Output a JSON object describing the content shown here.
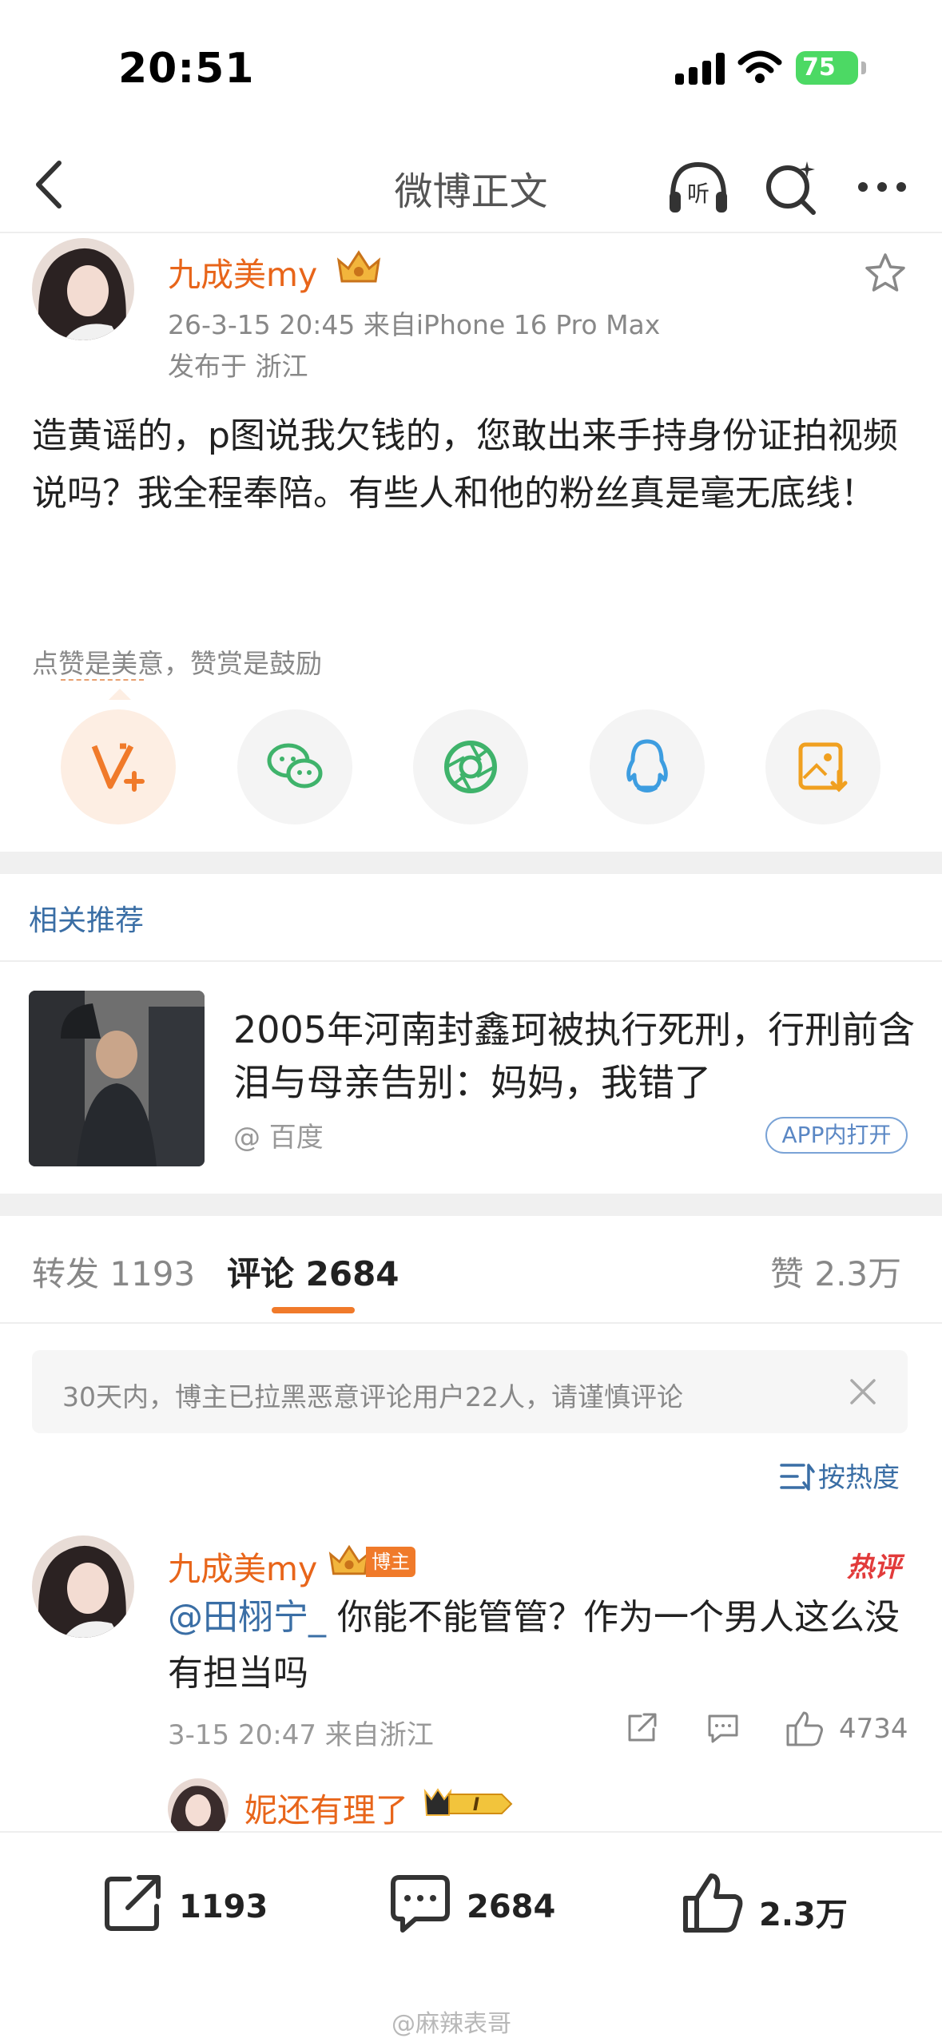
{
  "status_bar": {
    "time": "20:51",
    "battery": "75"
  },
  "nav": {
    "title": "微博正文"
  },
  "post": {
    "username": "九成美my",
    "meta": "26-3-15 20:45  来自iPhone 16 Pro Max",
    "location": "发布于 浙江",
    "body": "造黄谣的，p图说我欠钱的，您敢出来手持身份证拍视频说吗？我全程奉陪。有些人和他的粉丝真是毫无底线！",
    "reward_tip": "点赞是美意，赞赏是鼓励"
  },
  "related": {
    "section_title": "相关推荐",
    "headline": "2005年河南封鑫珂被执行死刑，行刑前含泪与母亲告别：妈妈，我错了",
    "source": "@ 百度",
    "open_label": "APP内打开"
  },
  "tabs": {
    "repost": "转发 1193",
    "comments": "评论 2684",
    "likes": "赞 2.3万"
  },
  "notice": "30天内，博主已拉黑恶意评论用户22人，请谨慎评论",
  "sort_label": "按热度",
  "comment": {
    "username": "九成美my",
    "owner_badge": "博主",
    "hot_badge": "热评",
    "mention": "@田栩宁_",
    "text": " 你能不能管管？作为一个男人这么没有担当吗",
    "meta": "3-15 20:47 来自浙江",
    "likes": "4734"
  },
  "reply": {
    "username": "妮还有理了",
    "level": "I"
  },
  "bottom_bar": {
    "repost_count": "1193",
    "comment_count": "2684",
    "like_count": "2.3万",
    "watermark": "@麻辣表哥"
  },
  "colors": {
    "accent_orange": "#e8651a",
    "link_blue": "#3a6ea5",
    "hot_red": "#e23b3b"
  }
}
